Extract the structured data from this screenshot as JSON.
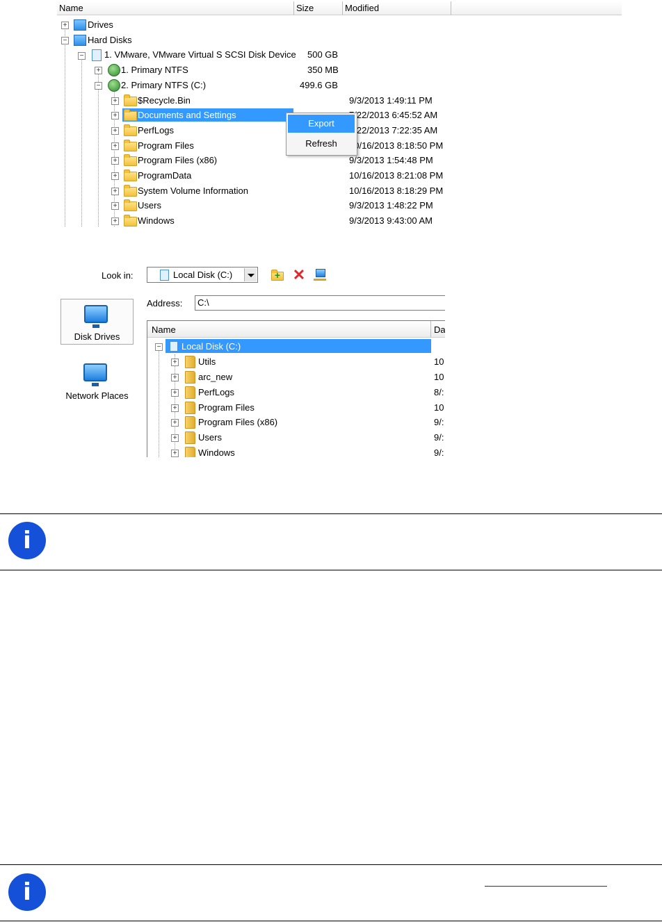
{
  "tree": {
    "columns": [
      {
        "label": "Name"
      },
      {
        "label": "Size"
      },
      {
        "label": "Modified"
      }
    ],
    "rows": [
      {
        "name": "Drives",
        "size": "",
        "modified": ""
      },
      {
        "name": "Hard Disks",
        "size": "",
        "modified": ""
      },
      {
        "name": "1. VMware, VMware Virtual S SCSI Disk Device",
        "size": "500 GB",
        "modified": ""
      },
      {
        "name": "1. Primary NTFS",
        "size": "350 MB",
        "modified": ""
      },
      {
        "name": "2. Primary NTFS (C:)",
        "size": "499.6 GB",
        "modified": ""
      },
      {
        "name": "$Recycle.Bin",
        "size": "",
        "modified": "9/3/2013 1:49:11 PM"
      },
      {
        "name": "Documents and Settings",
        "size": "",
        "modified": "7/22/2013 6:45:52 AM"
      },
      {
        "name": "PerfLogs",
        "size": "",
        "modified": "7/22/2013 7:22:35 AM"
      },
      {
        "name": "Program Files",
        "size": "",
        "modified": "10/16/2013 8:18:50 PM"
      },
      {
        "name": "Program Files (x86)",
        "size": "",
        "modified": "9/3/2013 1:54:48 PM"
      },
      {
        "name": "ProgramData",
        "size": "",
        "modified": "10/16/2013 8:21:08 PM"
      },
      {
        "name": "System Volume Information",
        "size": "",
        "modified": "10/16/2013 8:18:29 PM"
      },
      {
        "name": "Users",
        "size": "",
        "modified": "9/3/2013 1:48:22 PM"
      },
      {
        "name": "Windows",
        "size": "",
        "modified": "9/3/2013 9:43:00 AM"
      }
    ],
    "context_menu": {
      "export": "Export",
      "refresh": "Refresh"
    }
  },
  "dialog": {
    "look_in_label": "Look in:",
    "look_in_value": "Local Disk (C:)",
    "address_label": "Address:",
    "address_value": "C:\\",
    "places": [
      "Disk Drives",
      "Network Places"
    ],
    "list_columns": [
      "Name",
      "Da"
    ],
    "root": "Local Disk (C:)",
    "items": [
      {
        "name": "Utils",
        "date": "10"
      },
      {
        "name": "arc_new",
        "date": "10"
      },
      {
        "name": "PerfLogs",
        "date": "8/:"
      },
      {
        "name": "Program Files",
        "date": "10"
      },
      {
        "name": "Program Files (x86)",
        "date": "9/:"
      },
      {
        "name": "Users",
        "date": "9/:"
      },
      {
        "name": "Windows",
        "date": "9/:"
      }
    ]
  },
  "icons": {
    "info": "i"
  },
  "colors": {
    "selection": "#3399ff",
    "info": "#1451d8"
  }
}
